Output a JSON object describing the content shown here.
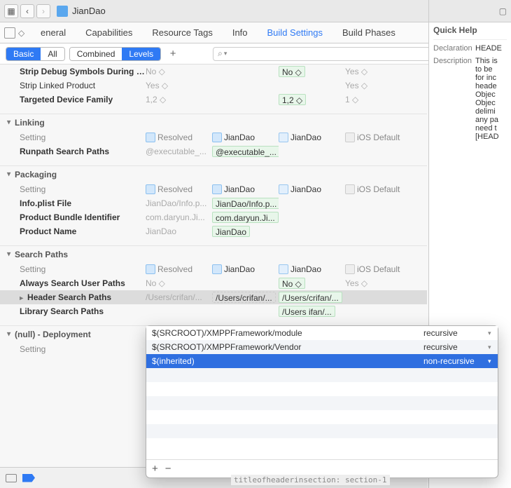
{
  "toolbar": {
    "nav_grid_icon": "grid",
    "project_name": "JianDao",
    "error_badge": "!"
  },
  "tabs": {
    "items": [
      "eneral",
      "Capabilities",
      "Resource Tags",
      "Info",
      "Build Settings",
      "Build Phases"
    ],
    "active_index": 4
  },
  "filters": {
    "group1": [
      "Basic",
      "All"
    ],
    "group1_active": 0,
    "group2": [
      "Combined",
      "Levels"
    ],
    "group2_active": 1,
    "plus": "+",
    "search_icon": "⌕",
    "search_dropdown": "▾"
  },
  "columns": {
    "setting": "Setting",
    "resolved": "Resolved",
    "target": "JianDao",
    "project": "JianDao",
    "default": "iOS Default"
  },
  "sections": {
    "top_rows": [
      {
        "name": "Strip Debug Symbols During C...",
        "bold": true,
        "c1": "No ◇",
        "c2": "",
        "c3": "No ◇",
        "c3_green": true,
        "c4": "Yes ◇"
      },
      {
        "name": "Strip Linked Product",
        "bold": false,
        "c1": "Yes ◇",
        "c2": "",
        "c3": "",
        "c4": "Yes ◇"
      },
      {
        "name": "Targeted Device Family",
        "bold": true,
        "c1": "1,2 ◇",
        "c2": "",
        "c3": "1,2 ◇",
        "c3_green": true,
        "c4": "1 ◇"
      }
    ],
    "linking": {
      "title": "Linking",
      "rows": [
        {
          "name": "Runpath Search Paths",
          "bold": true,
          "c1": "@executable_...",
          "c2": "@executable_...",
          "c2_green": true,
          "c3": "",
          "c4": ""
        }
      ]
    },
    "packaging": {
      "title": "Packaging",
      "rows": [
        {
          "name": "Info.plist File",
          "bold": true,
          "c1": "JianDao/Info.p...",
          "c2": "JianDao/Info.p...",
          "c2_green": true,
          "c3": "",
          "c4": ""
        },
        {
          "name": "Product Bundle Identifier",
          "bold": true,
          "c1": "com.daryun.Ji...",
          "c2": "com.daryun.Ji...",
          "c2_green": true,
          "c3": "",
          "c4": ""
        },
        {
          "name": "Product Name",
          "bold": true,
          "c1": "JianDao",
          "c2": "JianDao",
          "c2_green": true,
          "c3": "",
          "c4": ""
        }
      ]
    },
    "search_paths": {
      "title": "Search Paths",
      "rows": [
        {
          "name": "Always Search User Paths",
          "bold": true,
          "c1": "No ◇",
          "c2": "",
          "c3": "No ◇",
          "c3_green": true,
          "c4": "Yes ◇"
        },
        {
          "name": "Header Search Paths",
          "bold": true,
          "c1": "/Users/crifan/...",
          "c2": "/Users/crifan/...",
          "c2_dotted": true,
          "c3": "/Users/crifan/...",
          "c3_green": true,
          "c4": "",
          "selected": true
        },
        {
          "name": "Library Search Paths",
          "bold": true,
          "c1": "",
          "c2": "",
          "c3": "/Users  ifan/...",
          "c3_green": true,
          "c4": ""
        }
      ]
    },
    "null_deploy": {
      "title": "(null) - Deployment"
    }
  },
  "popover": {
    "rows": [
      {
        "path": "$(SRCROOT)/XMPPFramework/module",
        "rec": "recursive",
        "sel": false
      },
      {
        "path": "$(SRCROOT)/XMPPFramework/Vendor",
        "rec": "recursive",
        "sel": false
      },
      {
        "path": "$(inherited)",
        "rec": "non-recursive",
        "sel": true
      }
    ],
    "plus": "+",
    "minus": "−"
  },
  "quick_help": {
    "title": "Quick Help",
    "declaration_label": "Declaration",
    "declaration_value": "HEADE",
    "description_label": "Description",
    "description_value": "This is\nto be \nfor inc\nheade\nObjec\nObjec\ndelimi\nany pa\nneed t\n[HEAD"
  },
  "bottom_code": "titleofheaderinsection: section-1"
}
